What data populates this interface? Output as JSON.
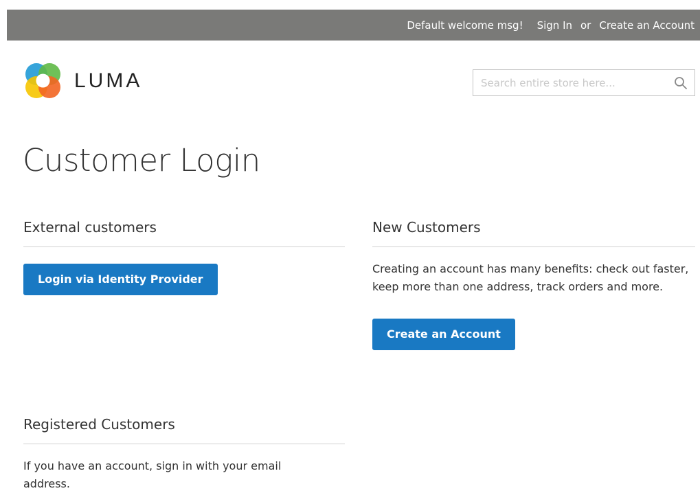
{
  "header": {
    "welcome": "Default welcome msg!",
    "sign_in": "Sign In",
    "or": "or",
    "create_account": "Create an Account"
  },
  "logo": {
    "text": "LUMA"
  },
  "search": {
    "placeholder": "Search entire store here...",
    "value": "",
    "icon": "search-icon"
  },
  "page": {
    "title": "Customer Login"
  },
  "external": {
    "title": "External customers",
    "button": "Login via Identity Provider"
  },
  "new_customers": {
    "title": "New Customers",
    "description": "Creating an account has many benefits: check out faster, keep more than one address, track orders and more.",
    "button": "Create an Account"
  },
  "registered": {
    "title": "Registered Customers",
    "description": "If you have an account, sign in with your email address."
  },
  "colors": {
    "topbar": "#7a7a78",
    "button": "#1979c3",
    "divider": "#d1d1d1"
  }
}
